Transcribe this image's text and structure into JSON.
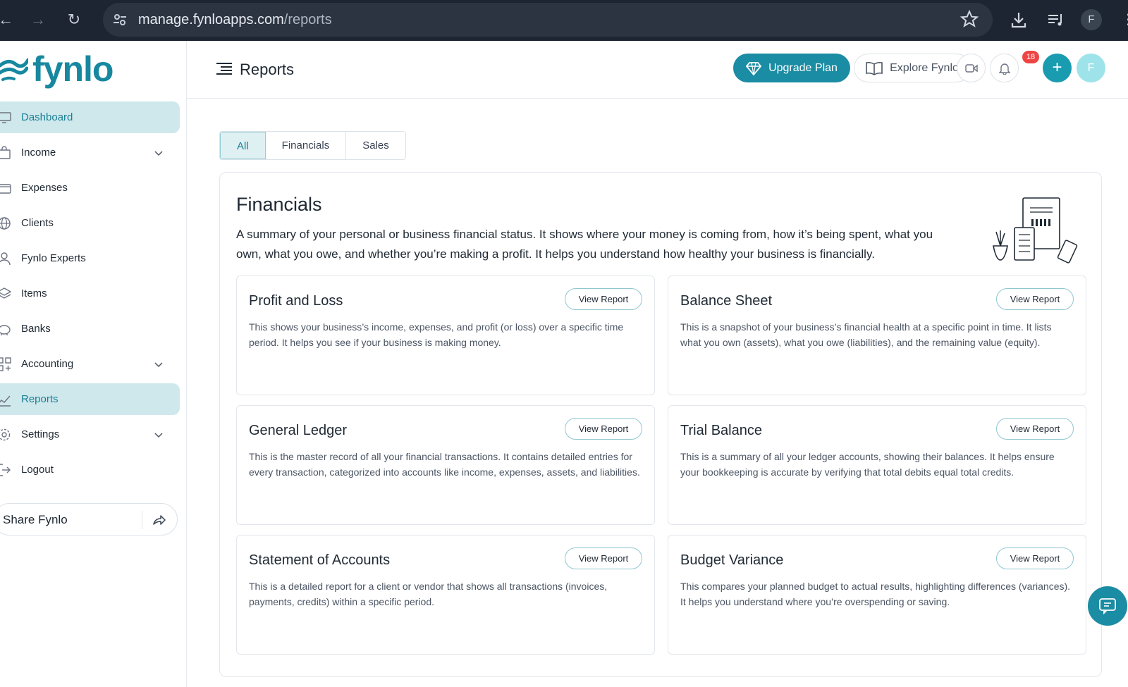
{
  "browser": {
    "url_host": "manage.fynloapps.com",
    "url_path": "/reports",
    "profile_initial": "F"
  },
  "sidebar": {
    "logo_text": "fynlo",
    "items": [
      {
        "label": "Dashboard",
        "icon": "monitor-icon",
        "active": true,
        "expandable": false
      },
      {
        "label": "Income",
        "icon": "shopping-bag-icon",
        "active": false,
        "expandable": true
      },
      {
        "label": "Expenses",
        "icon": "wallet-icon",
        "active": false,
        "expandable": false
      },
      {
        "label": "Clients",
        "icon": "globe-icon",
        "active": false,
        "expandable": false
      },
      {
        "label": "Fynlo Experts",
        "icon": "user-icon",
        "active": false,
        "expandable": false
      },
      {
        "label": "Items",
        "icon": "layers-icon",
        "active": false,
        "expandable": false
      },
      {
        "label": "Banks",
        "icon": "piggy-bank-icon",
        "active": false,
        "expandable": false
      },
      {
        "label": "Accounting",
        "icon": "grid-icon",
        "active": false,
        "expandable": true
      },
      {
        "label": "Reports",
        "icon": "chart-icon",
        "active": true,
        "expandable": false
      },
      {
        "label": "Settings",
        "icon": "gear-icon",
        "active": false,
        "expandable": true
      },
      {
        "label": "Logout",
        "icon": "logout-icon",
        "active": false,
        "expandable": false
      }
    ],
    "share_label": "Share Fynlo"
  },
  "header": {
    "title": "Reports",
    "upgrade_label": "Upgrade Plan",
    "explore_label": "Explore Fynlo",
    "notification_count": "18",
    "avatar_initial": "F",
    "add_label": "+"
  },
  "tabs": [
    {
      "label": "All",
      "active": true
    },
    {
      "label": "Financials",
      "active": false
    },
    {
      "label": "Sales",
      "active": false
    }
  ],
  "section": {
    "title": "Financials",
    "description": "A summary of your personal or business financial status. It shows where your money is coming from, how it’s being spent, what you own, what you owe, and whether you’re making a profit. It helps you understand how healthy your business is financially.",
    "view_label": "View Report",
    "reports": [
      {
        "title": "Profit and Loss",
        "description": "This shows your business’s income, expenses, and profit (or loss) over a specific time period. It helps you see if your business is making money."
      },
      {
        "title": "Balance Sheet",
        "description": "This is a snapshot of your business’s financial health at a specific point in time. It lists what you own (assets), what you owe (liabilities), and the remaining value (equity)."
      },
      {
        "title": "General Ledger",
        "description": "This is the master record of all your financial transactions. It contains detailed entries for every transaction, categorized into accounts like income, expenses, assets, and liabilities."
      },
      {
        "title": "Trial Balance",
        "description": "This is a summary of all your ledger accounts, showing their balances. It helps ensure your bookkeeping is accurate by verifying that total debits equal total credits."
      },
      {
        "title": "Statement of Accounts",
        "description": "This is a detailed report for a client or vendor that shows all transactions (invoices, payments, credits) within a specific period."
      },
      {
        "title": "Budget Variance",
        "description": "This compares your planned budget to actual results, highlighting differences (variances). It helps you understand where you’re overspending or saving."
      }
    ]
  },
  "colors": {
    "brand": "#1a8ca3",
    "active_bg": "#cfe8ec",
    "badge": "#ef4444"
  }
}
